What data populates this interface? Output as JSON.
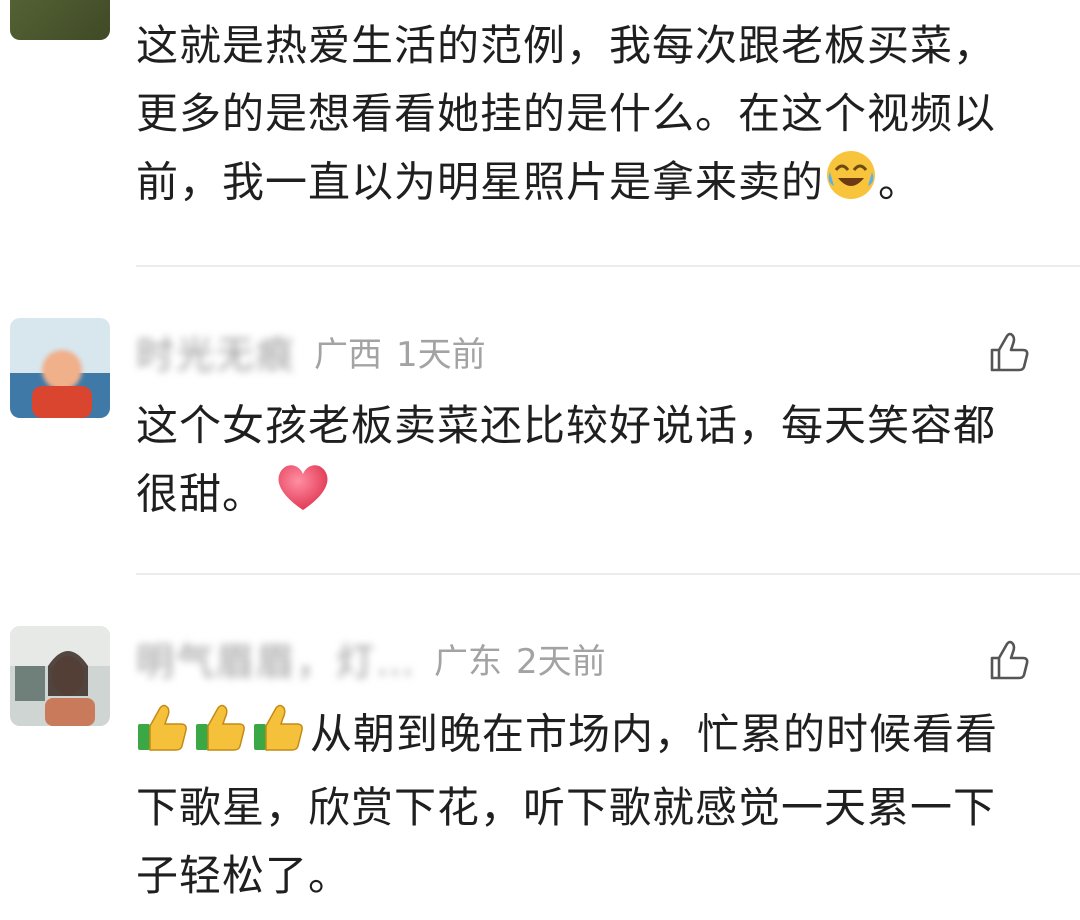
{
  "comments": [
    {
      "text": "这就是热爱生活的范例，我每次跟老板买菜，更多的是想看看她挂的是什么。在这个视频以前，我一直以为明星照片是拿来卖的",
      "text_end": "。",
      "emoji": "laughing-crying-emoji"
    },
    {
      "username": "时光无痕",
      "location": "广西",
      "time": "1天前",
      "text": "这个女孩老板卖菜还比较好说话，每天笑容都很甜。",
      "emoji": "red-heart-emoji"
    },
    {
      "username": "明气眉眉，灯…",
      "location": "广东",
      "time": "2天前",
      "prefix_emoji": [
        "thumbs-up-emoji",
        "thumbs-up-emoji",
        "thumbs-up-emoji"
      ],
      "text": "从朝到晚在市场内，忙累的时候看看下歌星，欣赏下花，听下歌就感觉一天累一下子轻松了。"
    }
  ],
  "icons": {
    "like": "thumbs-up-outline-icon"
  },
  "colors": {
    "text": "#1f1f1f",
    "meta": "#a3a3a3",
    "divider": "#ececec"
  }
}
